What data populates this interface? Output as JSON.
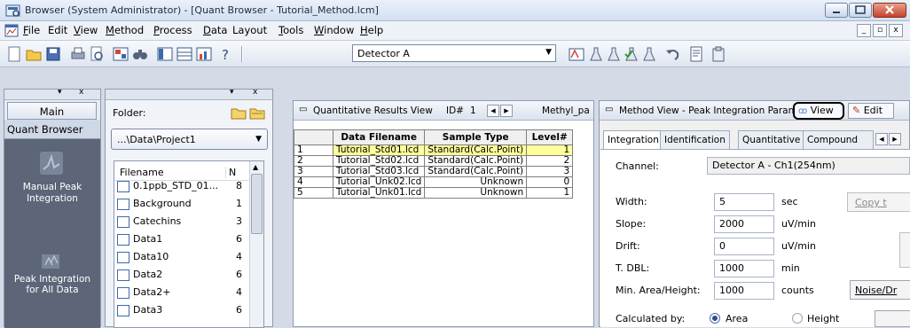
{
  "window": {
    "title": "Browser (System Administrator) - [Quant Browser - Tutorial_Method.lcm]"
  },
  "menu": {
    "items": [
      {
        "accel": "F",
        "rest": "ile"
      },
      {
        "accel": "",
        "rest": "Edit"
      },
      {
        "accel": "V",
        "rest": "iew",
        "pre": ""
      },
      {
        "accel": "M",
        "rest": "ethod"
      },
      {
        "accel": "P",
        "rest": "rocess"
      },
      {
        "accel": "D",
        "rest": "ata"
      },
      {
        "accel": "",
        "rest": "Layout"
      },
      {
        "accel": "T",
        "rest": "ools"
      },
      {
        "accel": "W",
        "rest": "indow"
      },
      {
        "accel": "H",
        "rest": "elp"
      }
    ]
  },
  "toolbar": {
    "detector": "Detector A",
    "help_glyph": "?"
  },
  "main_panel": {
    "header": "Main",
    "section": "Quant Browser",
    "items": [
      "Manual Peak Integration",
      "Peak Integration for All Data"
    ]
  },
  "folder_panel": {
    "label": "Folder:",
    "path": "...\\Data\\Project1",
    "col_name": "Filename",
    "col2": "N",
    "files": [
      {
        "name": "0.1ppb_STD_01...",
        "n": "8"
      },
      {
        "name": "Background",
        "n": "1"
      },
      {
        "name": "Catechins",
        "n": "3"
      },
      {
        "name": "Data1",
        "n": "6"
      },
      {
        "name": "Data10",
        "n": "4"
      },
      {
        "name": "Data2",
        "n": "6"
      },
      {
        "name": "Data2+",
        "n": "4"
      },
      {
        "name": "Data3",
        "n": "6"
      }
    ]
  },
  "quant_results": {
    "title": "Quantitative Results View",
    "id_label": "ID#",
    "id_value": "1",
    "compound": "Methyl_pa",
    "headers": [
      "Data Filename",
      "Sample Type",
      "Level#"
    ],
    "rows": [
      {
        "n": "1",
        "file": "Tutorial_Std01.lcd",
        "type": "Standard(Calc.Point)",
        "level": "1"
      },
      {
        "n": "2",
        "file": "Tutorial_Std02.lcd",
        "type": "Standard(Calc.Point)",
        "level": "2"
      },
      {
        "n": "3",
        "file": "Tutorial_Std03.lcd",
        "type": "Standard(Calc.Point)",
        "level": "3"
      },
      {
        "n": "4",
        "file": "Tutorial_Unk02.lcd",
        "type": "Unknown",
        "level": "0"
      },
      {
        "n": "5",
        "file": "Tutorial_Unk01.lcd",
        "type": "Unknown",
        "level": "1"
      }
    ]
  },
  "method_view": {
    "title": "Method View - Peak Integration Paran",
    "view_btn": "View",
    "edit_btn": "Edit",
    "tabs": [
      "Integration",
      "Identification",
      "Quantitative",
      "Compound"
    ],
    "channel_label": "Channel:",
    "channel_value": "Detector A - Ch1(254nm)",
    "fields": [
      {
        "label": "Width:",
        "value": "5",
        "unit": "sec"
      },
      {
        "label": "Slope:",
        "value": "2000",
        "unit": "uV/min"
      },
      {
        "label": "Drift:",
        "value": "0",
        "unit": "uV/min"
      },
      {
        "label": "T. DBL:",
        "value": "1000",
        "unit": "min"
      },
      {
        "label": "Min. Area/Height:",
        "value": "1000",
        "unit": "counts"
      }
    ],
    "copy_btn": "Copy t",
    "noise_btn": "Noise/Dr",
    "calc_label": "Calculated by:",
    "radio_area": "Area",
    "radio_height": "Height"
  },
  "colors": {
    "selected_row": "#ffff99",
    "main_panel_bg": "#5a6478",
    "accent": "#2f4f8a"
  }
}
